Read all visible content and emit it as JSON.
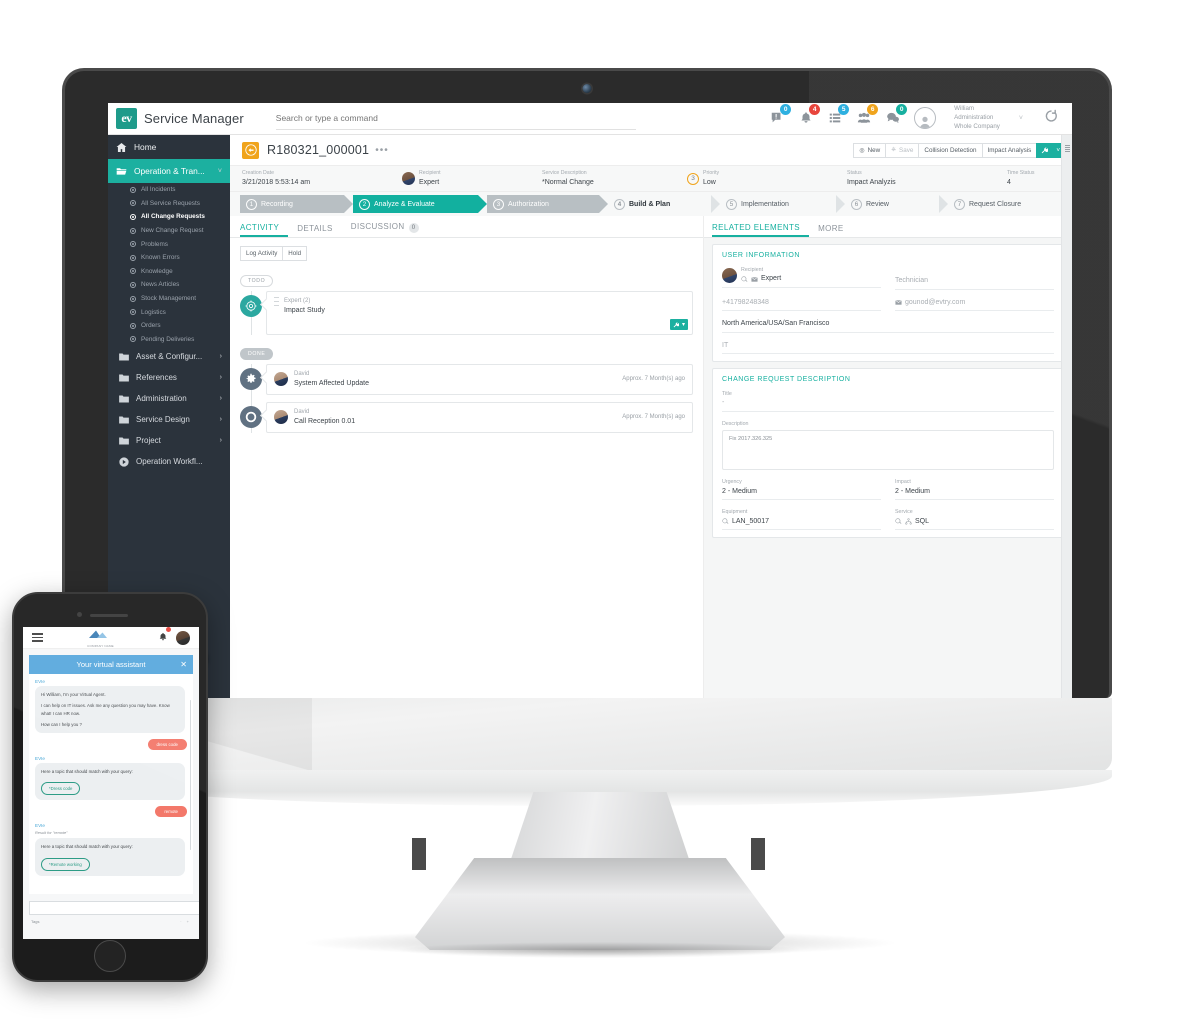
{
  "app": {
    "brand_mark": "ev",
    "brand_name": "Service Manager",
    "search_placeholder": "Search or type a command",
    "accent_teal": "#17b0a0",
    "sidebar_bg": "#2b333c"
  },
  "topbar": {
    "icons": [
      {
        "name": "announcement-icon",
        "badge": "0",
        "badge_color": "#2eb0e0"
      },
      {
        "name": "bell-icon",
        "badge": "4",
        "badge_color": "#e8453c"
      },
      {
        "name": "list-icon",
        "badge": "5",
        "badge_color": "#2eb0e0"
      },
      {
        "name": "team-icon",
        "badge": "6",
        "badge_color": "#f0a41c"
      },
      {
        "name": "chat-icon",
        "badge": "0",
        "badge_color": "#17b0a0"
      }
    ],
    "user": {
      "name": "William",
      "role": "Administration",
      "scope": "Whole Company"
    },
    "caret": "˅",
    "logout_label": "logout-icon"
  },
  "sidebar": {
    "home": {
      "label": "Home",
      "icon": "home-icon"
    },
    "active_group": {
      "label": "Operation & Tran...",
      "icon": "open-folder-icon",
      "chevron": "˅"
    },
    "sub_items": [
      {
        "label": "All Incidents",
        "selected": false
      },
      {
        "label": "All Service Requests",
        "selected": false
      },
      {
        "label": "All Change Requests",
        "selected": true
      },
      {
        "label": "New Change Request",
        "selected": false
      },
      {
        "label": "Problems",
        "selected": false
      },
      {
        "label": "Known Errors",
        "selected": false
      },
      {
        "label": "Knowledge",
        "selected": false
      },
      {
        "label": "News Articles",
        "selected": false
      },
      {
        "label": "Stock Management",
        "selected": false
      },
      {
        "label": "Logistics",
        "selected": false
      },
      {
        "label": "Orders",
        "selected": false
      },
      {
        "label": "Pending Deliveries",
        "selected": false
      }
    ],
    "folders": [
      {
        "label": "Asset & Configur...",
        "icon": "folder-icon",
        "chevron": "›"
      },
      {
        "label": "References",
        "icon": "folder-icon",
        "chevron": "›"
      },
      {
        "label": "Administration",
        "icon": "folder-icon",
        "chevron": "›"
      },
      {
        "label": "Service Design",
        "icon": "folder-icon",
        "chevron": "›"
      },
      {
        "label": "Project",
        "icon": "folder-icon",
        "chevron": "›"
      },
      {
        "label": "Operation Workfl...",
        "icon": "workflow-icon",
        "chevron": ""
      }
    ],
    "fab": "edit-pencil-fab"
  },
  "record": {
    "icon": "change-request-icon",
    "title": "R180321_000001",
    "more": "•••",
    "toolbar": {
      "new": "New",
      "save": "Save",
      "collision": "Collision Detection",
      "impact": "Impact Analysis",
      "action_icon": "wrench-icon",
      "caret": "˅"
    },
    "meta": [
      {
        "label": "Creation Date",
        "value": "3/21/2018 5:53:14 am"
      },
      {
        "label": "Recipient",
        "value": "Expert"
      },
      {
        "label": "Service Description",
        "value": "*Normal Change"
      },
      {
        "label": "Priority",
        "value": "Low",
        "ring": "3"
      },
      {
        "label": "Status",
        "value": "Impact Analyzis"
      },
      {
        "label": "Time Status",
        "value": "4"
      }
    ]
  },
  "workflow": {
    "steps": [
      {
        "num": "1",
        "label": "Recording",
        "state": "gray"
      },
      {
        "num": "2",
        "label": "Analyze & Evaluate",
        "state": "teal"
      },
      {
        "num": "3",
        "label": "Authorization",
        "state": "gray"
      },
      {
        "num": "4",
        "label": "Build & Plan",
        "state": "white-bold"
      },
      {
        "num": "5",
        "label": "Implementation",
        "state": "white"
      },
      {
        "num": "6",
        "label": "Review",
        "state": "white"
      },
      {
        "num": "7",
        "label": "Request Closure",
        "state": "white"
      }
    ]
  },
  "left_pane": {
    "tabs": [
      {
        "label": "ACTIVITY",
        "active": true,
        "count": null
      },
      {
        "label": "DETAILS",
        "active": false,
        "count": null
      },
      {
        "label": "DISCUSSION",
        "active": false,
        "count": "0"
      }
    ],
    "buttons": [
      "Log Activity",
      "Hold"
    ],
    "groups": [
      {
        "pill": "TODO",
        "pill_style": "outline",
        "items": [
          {
            "node": "target-icon",
            "node_style": "teal",
            "name": "Expert (2)",
            "subject": "Impact Study",
            "time": "",
            "big": true,
            "zoom_button": "wrench-icon"
          }
        ]
      },
      {
        "pill": "DONE",
        "pill_style": "filled",
        "items": [
          {
            "node": "gear-icon",
            "node_style": "slate",
            "name": "David",
            "subject": "System Affected Update",
            "time": "Approx. 7 Month(s) ago",
            "big": false
          },
          {
            "node": "phone-circle-icon",
            "node_style": "slate",
            "name": "David",
            "subject": "Call Reception 0.01",
            "time": "Approx. 7 Month(s) ago",
            "big": false
          }
        ]
      }
    ]
  },
  "right_pane": {
    "tabs": [
      {
        "label": "RELATED ELEMENTS",
        "active": true
      },
      {
        "label": "MORE",
        "active": false
      }
    ],
    "user_information": {
      "heading": "USER INFORMATION",
      "recipient_label": "Recipient",
      "recipient_value": "Expert",
      "recipient_icons": [
        "search-icon",
        "mail-icon"
      ],
      "technician_placeholder": "Technician",
      "phone": "+41798248348",
      "email": "gounod@evtry.com",
      "email_icon": "mail-icon",
      "location": "North America/USA/San Francisco",
      "department": "IT"
    },
    "change_request_description": {
      "heading": "CHANGE REQUEST DESCRIPTION",
      "title_label": "Title",
      "title_value": "-",
      "description_label": "Description",
      "description_value": "Fix 2017.326.325",
      "urgency_label": "Urgency",
      "urgency_value": "2 - Medium",
      "impact_label": "Impact",
      "impact_value": "2 - Medium",
      "equipment_label": "Equipment",
      "equipment_value": "LAN_50017",
      "equipment_icon": "search-icon",
      "service_label": "Service",
      "service_value": "SQL",
      "service_icons": [
        "search-icon",
        "network-icon"
      ]
    }
  },
  "phone": {
    "nav": {
      "menu_icon": "hamburger-icon",
      "logo_text": "COMPANY NAME",
      "bell_icon": "bell-icon",
      "avatar": "user-avatar"
    },
    "chat": {
      "header": "Your virtual assistant",
      "close": "✕",
      "messages": [
        {
          "from": "side",
          "who": "EVIe",
          "lines": [
            "Hi William, I'm your Virtual Agent.",
            "I can help on IT issues. Ask me any question you may have. Know what! I can HR now.",
            "How can I help you ?"
          ]
        },
        {
          "from": "user",
          "text": "dress code"
        },
        {
          "from": "side",
          "who": "EVIe",
          "lines": [
            "Here a topic that should match with your query:"
          ],
          "chip": "*Dress code"
        },
        {
          "from": "user",
          "text": "remote"
        },
        {
          "from": "side",
          "who": "EVIe",
          "result_for": "Result for \"remote\"",
          "lines": [
            "Here a topic that should match with your query:"
          ],
          "chip": "*Remote working"
        }
      ],
      "input_placeholder": "",
      "send_icon": "send-icon",
      "tags_label": "Tags",
      "tags_right": "· +"
    }
  }
}
